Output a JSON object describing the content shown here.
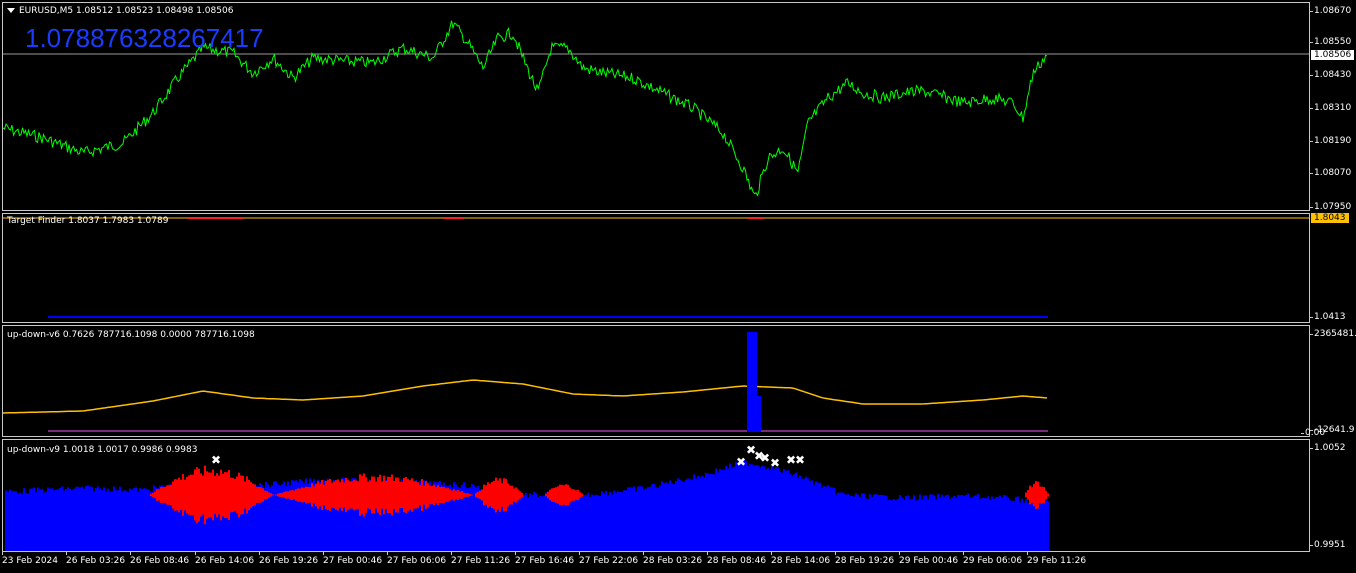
{
  "main_chart": {
    "symbol_label": "EURUSD,M5  1.08512 1.08523 1.08498 1.08506",
    "big_value": "1.07887632826​7417",
    "current_price": "1.08506",
    "price_ticks": [
      "1.08670",
      "1.08550",
      "1.08430",
      "1.08310",
      "1.08190",
      "1.08070",
      "1.07950"
    ],
    "line_color": "#00ff00",
    "price_tag_color": "#ffffff"
  },
  "target_finder": {
    "label": "Target Finder 1.8037 1.7983 1.0789",
    "current_value": "1.8043",
    "ticks": [
      "1.0413"
    ],
    "tag_color": "#ffc000",
    "line_color": "#0000ff"
  },
  "up_down_v6": {
    "label": "up-down-v6 0.7626 787716.1098 0.0000 787716.1098",
    "ticks": [
      "2365481.9",
      "-12641.9",
      "0.00"
    ],
    "line_color": "#ffc000",
    "bar_color": "#0000ff"
  },
  "up_down_v9": {
    "label": "up-down-v9 1.0018 1.0017 0.9986 0.9983",
    "ticks": [
      "1.0052",
      "0.9951"
    ],
    "up_color": "#0000ff",
    "down_color": "#ff0000",
    "marker_color": "#ffffff"
  },
  "time_axis": {
    "labels": [
      "23 Feb 2024",
      "26 Feb 03:26",
      "26 Feb 08:46",
      "26 Feb 14:06",
      "26 Feb 19:26",
      "27 Feb 00:46",
      "27 Feb 06:06",
      "27 Feb 11:26",
      "27 Feb 16:46",
      "27 Feb 22:06",
      "28 Feb 03:26",
      "28 Feb 08:46",
      "28 Feb 14:06",
      "28 Feb 19:26",
      "29 Feb 00:46",
      "29 Feb 06:06",
      "29 Feb 11:26"
    ]
  }
}
